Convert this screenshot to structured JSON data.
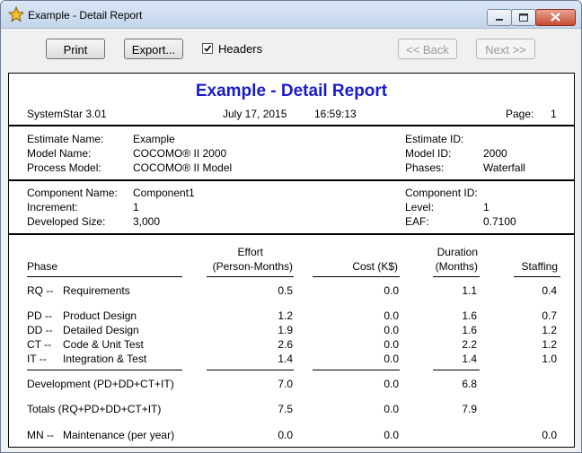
{
  "window": {
    "title": "Example - Detail Report"
  },
  "toolbar": {
    "print_label": "Print",
    "export_label": "Export...",
    "headers_label": "Headers",
    "headers_checked": true,
    "back_label": "<< Back",
    "next_label": "Next >>"
  },
  "report": {
    "title": "Example - Detail Report",
    "product": "SystemStar 3.01",
    "date": "July 17, 2015",
    "time": "16:59:13",
    "page_label": "Page:",
    "page_number": "1",
    "estimate": [
      {
        "label": "Estimate Name:",
        "value": "Example"
      },
      {
        "label": "Model Name:",
        "value": "COCOMO® II 2000"
      },
      {
        "label": "Process Model:",
        "value": "COCOMO® II Model"
      }
    ],
    "estimate_right": [
      {
        "label": "Estimate ID:",
        "value": ""
      },
      {
        "label": "Model ID:",
        "value": "2000"
      },
      {
        "label": "Phases:",
        "value": "Waterfall"
      }
    ],
    "component": [
      {
        "label": "Component Name:",
        "value": "Component1"
      },
      {
        "label": "Increment:",
        "value": "1"
      },
      {
        "label": "Developed Size:",
        "value": "3,000"
      }
    ],
    "component_right": [
      {
        "label": "Component ID:",
        "value": ""
      },
      {
        "label": "Level:",
        "value": "1"
      },
      {
        "label": "EAF:",
        "value": "0.7100"
      }
    ],
    "columns": {
      "phase": "Phase",
      "effort_1": "Effort",
      "effort_2": "(Person-Months)",
      "cost": "Cost (K$)",
      "duration_1": "Duration",
      "duration_2": "(Months)",
      "staffing": "Staffing"
    },
    "rows": [
      {
        "code": "RQ --",
        "name": "Requirements",
        "effort": "0.5",
        "cost": "0.0",
        "duration": "1.1",
        "staffing": "0.4"
      },
      {
        "code": "PD --",
        "name": "Product Design",
        "effort": "1.2",
        "cost": "0.0",
        "duration": "1.6",
        "staffing": "0.7"
      },
      {
        "code": "DD --",
        "name": "Detailed Design",
        "effort": "1.9",
        "cost": "0.0",
        "duration": "1.6",
        "staffing": "1.2"
      },
      {
        "code": "CT --",
        "name": "Code & Unit Test",
        "effort": "2.6",
        "cost": "0.0",
        "duration": "2.2",
        "staffing": "1.2"
      },
      {
        "code": "IT --",
        "name": "Integration & Test",
        "effort": "1.4",
        "cost": "0.0",
        "duration": "1.4",
        "staffing": "1.0"
      }
    ],
    "development": {
      "label": "Development (PD+DD+CT+IT)",
      "effort": "7.0",
      "cost": "0.0",
      "duration": "6.8",
      "staffing": ""
    },
    "totals": {
      "label": "Totals (RQ+PD+DD+CT+IT)",
      "effort": "7.5",
      "cost": "0.0",
      "duration": "7.9",
      "staffing": ""
    },
    "maintenance": {
      "code": "MN --",
      "name": "Maintenance (per year)",
      "effort": "0.0",
      "cost": "0.0",
      "duration": "",
      "staffing": "0.0"
    }
  }
}
